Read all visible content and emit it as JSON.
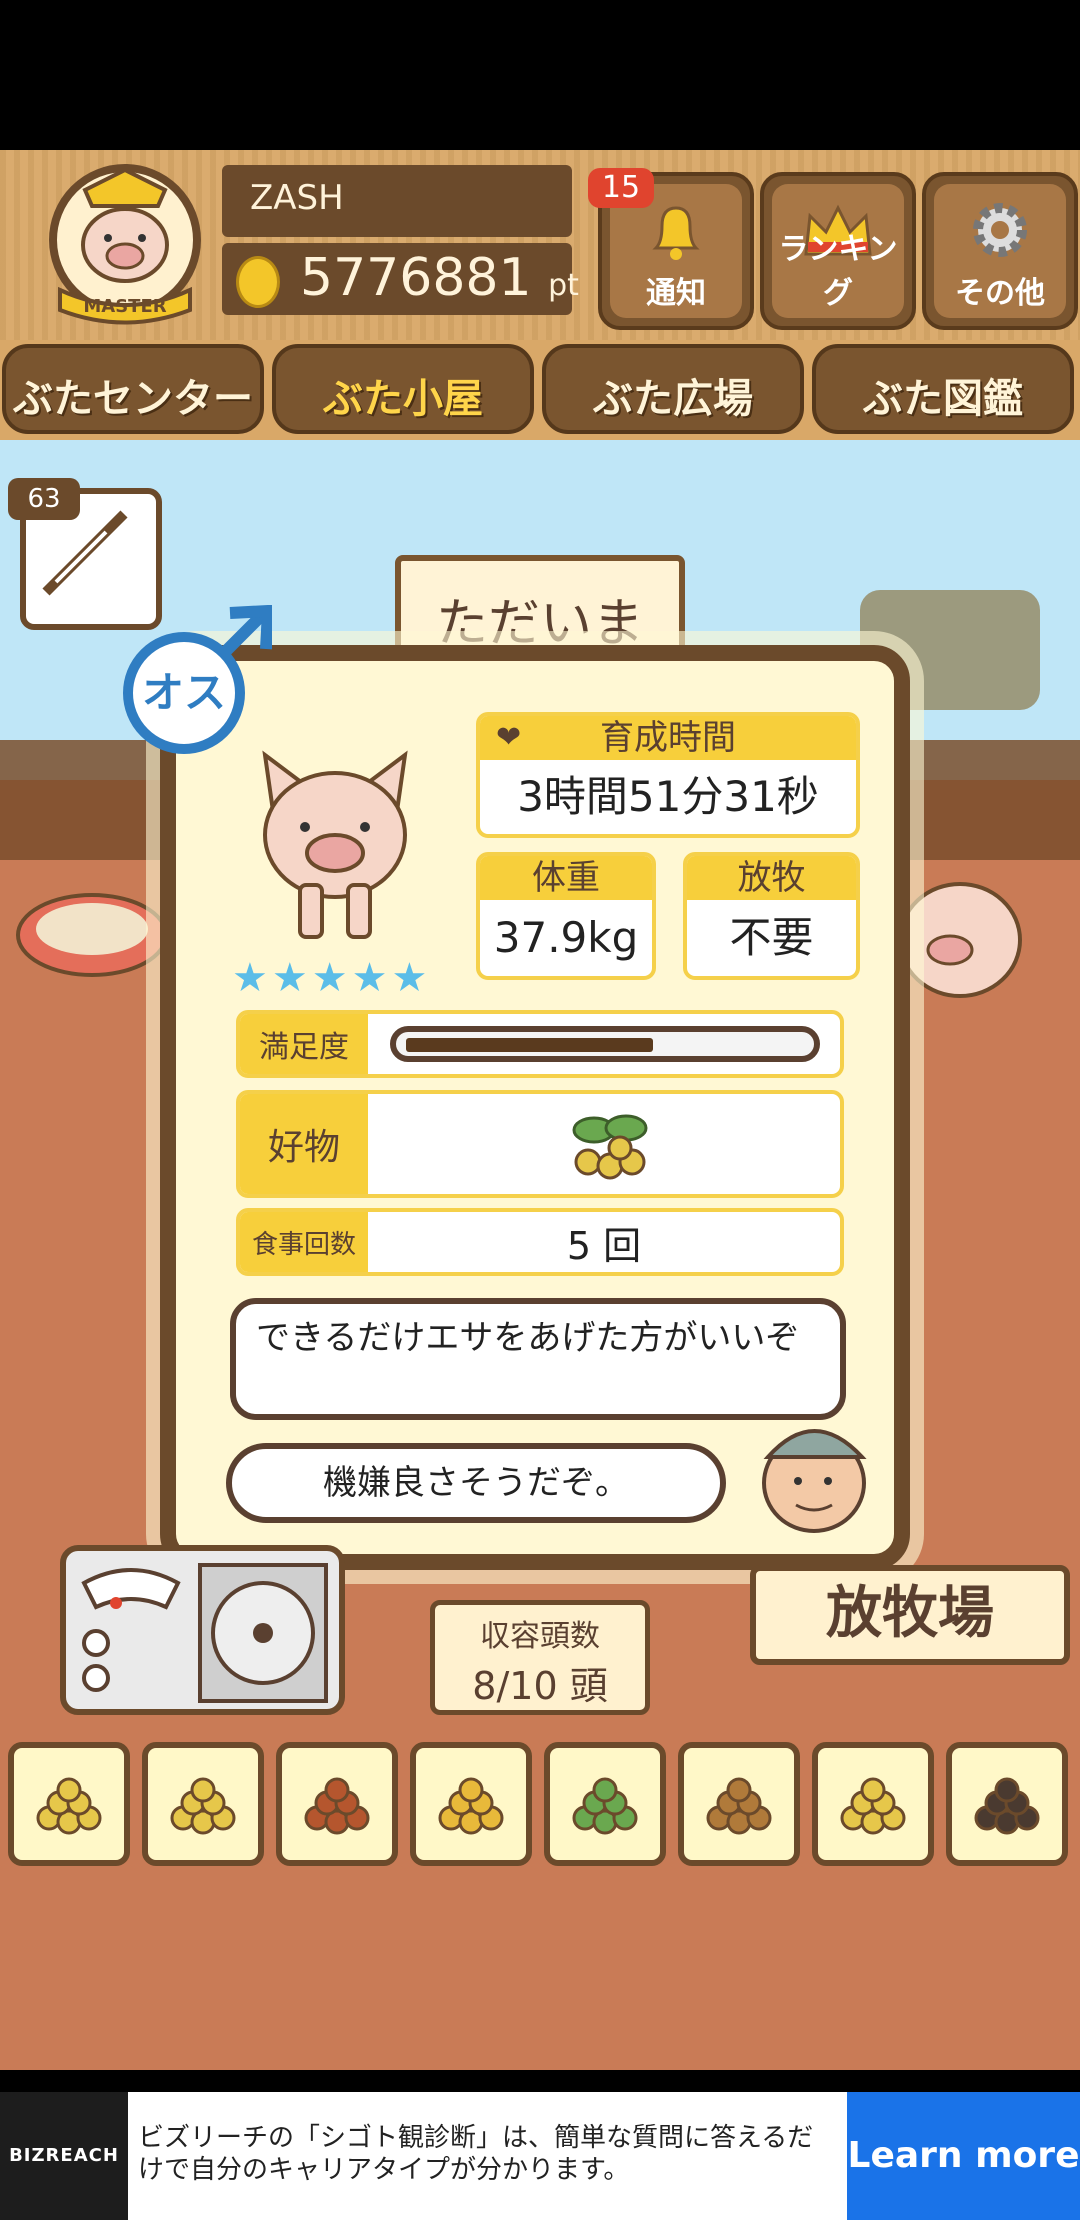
{
  "header": {
    "rank_badge": "MASTER",
    "player_name": "ZASH",
    "points_value": "5776881",
    "points_unit": "pt",
    "notification_count": "15",
    "buttons": [
      {
        "label": "通知",
        "icon": "bell-icon"
      },
      {
        "label": "ランキング",
        "icon": "crown-icon"
      },
      {
        "label": "その他",
        "icon": "gear-icon"
      }
    ]
  },
  "nav": {
    "tabs": [
      {
        "label": "ぶたセンター",
        "active": false
      },
      {
        "label": "ぶた小屋",
        "active": true
      },
      {
        "label": "ぶた広場",
        "active": false
      },
      {
        "label": "ぶた図鑑",
        "active": false
      }
    ]
  },
  "scene": {
    "syringe_count": "63",
    "sign_text": "ただいま"
  },
  "pig_card": {
    "gender": "オス",
    "stars": "★★★★★",
    "rearing_time_label": "育成時間",
    "rearing_time_value": "3時間51分31秒",
    "weight_label": "体重",
    "weight_value": "37.9kg",
    "grazing_label": "放牧",
    "grazing_value": "不要",
    "satisfaction_label": "満足度",
    "satisfaction_level": 0.62,
    "favorite_label": "好物",
    "favorite_icon": "soybean-icon",
    "meals_label": "食事回数",
    "meals_value": "5 回",
    "advice_text": "できるだけエサをあげた方がいいぞ",
    "mood_text": "機嫌良さそうだぞ。"
  },
  "barn": {
    "capacity_label": "収容頭数",
    "capacity_value": "8/10 頭",
    "pasture_sign": "放牧場"
  },
  "feeds": [
    "grain-feed-icon",
    "mixed-grain-icon",
    "sweet-potato-icon",
    "corn-icon",
    "soybean-icon",
    "acorn-icon",
    "bowl-grain-icon",
    "truffle-icon"
  ],
  "colors": {
    "wood": "#d9a868",
    "dark_wood": "#6b4a2b",
    "card_bg": "#fff8d4",
    "label_yellow": "#f7cf3b",
    "star_blue": "#5bbde8",
    "ad_button": "#1a73e8"
  },
  "ad": {
    "logo": "BIZREACH",
    "text": "ビズリーチの「シゴト観診断」は、簡単な質問に答えるだけで自分のキャリアタイプが分かります。",
    "button": "Learn more"
  }
}
